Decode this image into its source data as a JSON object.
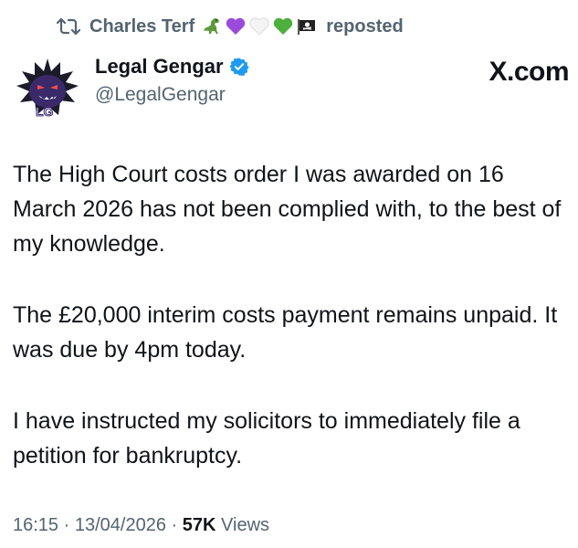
{
  "repost": {
    "reposter_name": "Charles Terf",
    "reposted_label": "reposted",
    "emoji_icons": [
      "dinosaur-emoji",
      "purple-heart-emoji",
      "white-heart-emoji",
      "green-heart-emoji",
      "pirate-flag-emoji"
    ]
  },
  "author": {
    "display_name": "Legal Gengar",
    "handle": "@LegalGengar",
    "verified": true,
    "avatar_text": "LG"
  },
  "branding": {
    "site_label": "X.com"
  },
  "post": {
    "paragraphs": [
      "The High Court costs order I was awarded on 16 March 2026 has not been complied with, to the best of my knowledge.",
      "The £20,000 interim costs payment remains unpaid. It was due by 4pm today.",
      "I have instructed my solicitors to immediately file a petition for bankruptcy."
    ]
  },
  "meta": {
    "time": "16:15",
    "separator": "·",
    "date": "13/04/2026",
    "views_count": "57K",
    "views_label": "Views"
  },
  "colors": {
    "muted": "#536471",
    "text": "#0f1419",
    "verified_blue": "#1d9bf0"
  }
}
